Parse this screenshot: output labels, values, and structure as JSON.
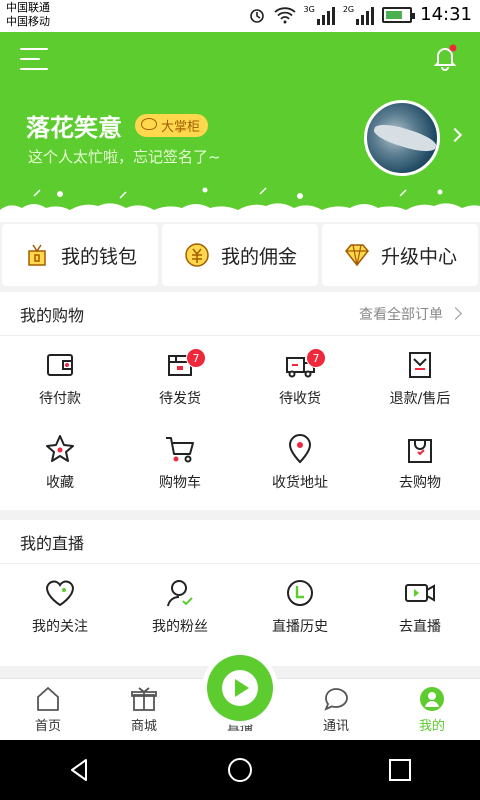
{
  "status_bar": {
    "carrier1": "中国联通",
    "carrier2": "中国移动",
    "net1": "3G",
    "net2": "2G",
    "time": "14:31"
  },
  "profile": {
    "username": "落花笑意",
    "level_badge": "大掌柜",
    "signature": "这个人太忙啦，忘记签名了~"
  },
  "wallet": [
    {
      "label": "我的钱包",
      "icon": "wallet-icon"
    },
    {
      "label": "我的佣金",
      "icon": "commission-icon"
    },
    {
      "label": "升级中心",
      "icon": "diamond-icon"
    }
  ],
  "shopping": {
    "title": "我的购物",
    "link": "查看全部订单",
    "items": [
      {
        "label": "待付款",
        "icon": "wallet-pay-icon",
        "count": ""
      },
      {
        "label": "待发货",
        "icon": "box-icon",
        "count": "7"
      },
      {
        "label": "待收货",
        "icon": "truck-icon",
        "count": "7"
      },
      {
        "label": "退款/售后",
        "icon": "refund-icon",
        "count": ""
      },
      {
        "label": "收藏",
        "icon": "star-icon",
        "count": ""
      },
      {
        "label": "购物车",
        "icon": "cart-icon",
        "count": ""
      },
      {
        "label": "收货地址",
        "icon": "location-icon",
        "count": ""
      },
      {
        "label": "去购物",
        "icon": "shopping-bag-icon",
        "count": ""
      }
    ]
  },
  "live": {
    "title": "我的直播",
    "items": [
      {
        "label": "我的关注",
        "icon": "heart-icon"
      },
      {
        "label": "我的粉丝",
        "icon": "fans-icon"
      },
      {
        "label": "直播历史",
        "icon": "history-icon"
      },
      {
        "label": "去直播",
        "icon": "video-camera-icon"
      }
    ]
  },
  "tabs": [
    {
      "label": "首页",
      "icon": "home-icon"
    },
    {
      "label": "商城",
      "icon": "gift-icon"
    },
    {
      "label": "直播",
      "icon": "play-icon"
    },
    {
      "label": "通讯",
      "icon": "chat-icon"
    },
    {
      "label": "我的",
      "icon": "profile-icon",
      "active": true
    }
  ],
  "colors": {
    "accent": "#5ccc2e",
    "badge": "#f0283c",
    "vip": "#ffd84d"
  }
}
